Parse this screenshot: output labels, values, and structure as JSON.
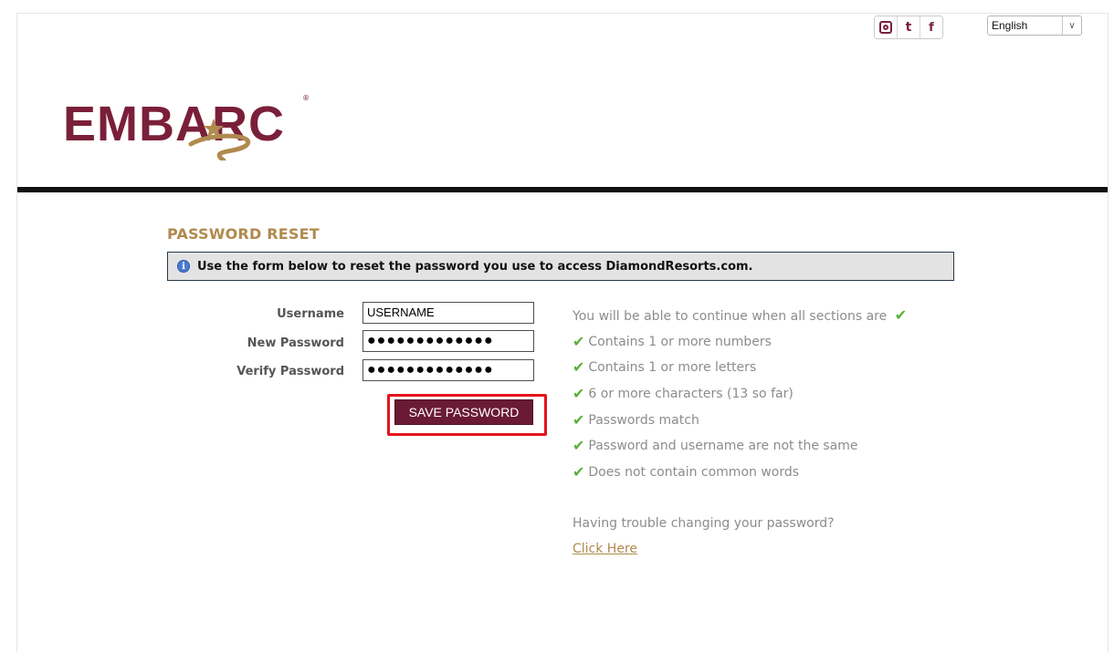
{
  "header": {
    "social": [
      {
        "name": "instagram-icon"
      },
      {
        "name": "twitter-icon",
        "glyph": "t"
      },
      {
        "name": "facebook-icon",
        "glyph": "f"
      }
    ],
    "language": {
      "selected": "English"
    },
    "logo_text": "EMBARC"
  },
  "page": {
    "title": "PASSWORD RESET",
    "info_text": "Use the form below to reset the password you use to access DiamondResorts.com."
  },
  "form": {
    "username_label": "Username",
    "username_value": "USERNAME",
    "new_password_label": "New Password",
    "new_password_value": "●●●●●●●●●●●●●",
    "verify_password_label": "Verify Password",
    "verify_password_value": "●●●●●●●●●●●●●",
    "save_label": "SAVE PASSWORD"
  },
  "requirements": {
    "heading": "You will be able to continue when all sections are",
    "items": [
      "Contains 1 or more numbers",
      "Contains 1 or more letters",
      "6 or more characters (13 so far)",
      "Passwords match",
      "Password and username are not the same",
      "Does not contain common words"
    ]
  },
  "help": {
    "trouble_text": "Having trouble changing your password?",
    "link_label": "Click Here"
  },
  "colors": {
    "brand_maroon": "#7a1f3a",
    "gold": "#b08a4e",
    "check_green": "#59b039",
    "highlight_red": "#e4141c"
  }
}
